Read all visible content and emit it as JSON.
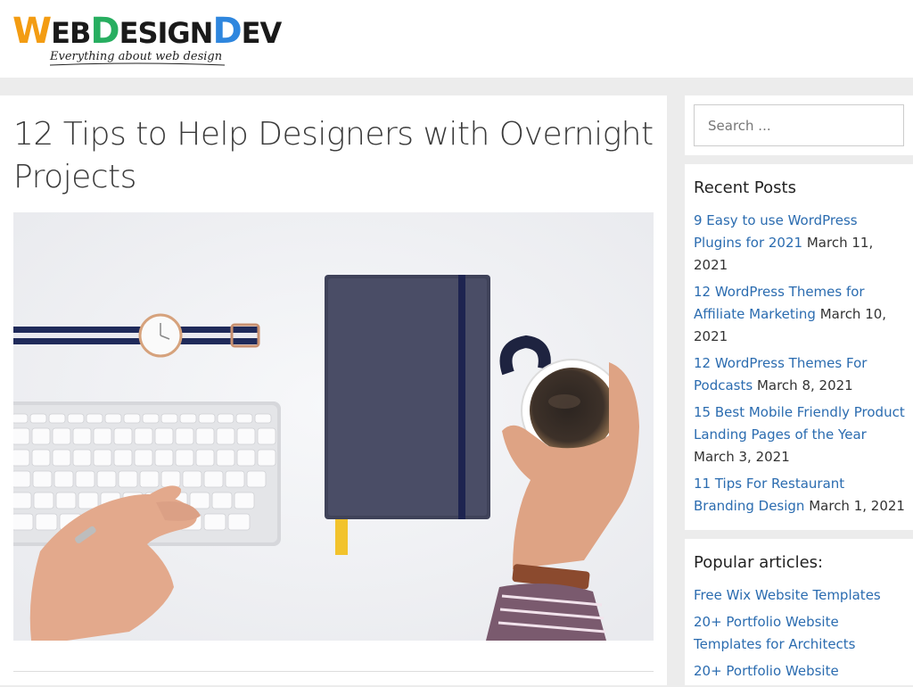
{
  "header": {
    "logo": {
      "w": "W",
      "eb": "EB",
      "d": "D",
      "esign": "ESIGN",
      "d2": "D",
      "ev": "EV",
      "tagline": "Everything about web design"
    }
  },
  "article": {
    "title": "12 Tips to Help Designers with Overnight Projects"
  },
  "sidebar": {
    "search": {
      "placeholder": "Search ..."
    },
    "recent_posts": {
      "title": "Recent Posts",
      "items": [
        {
          "label": "9 Easy to use WordPress Plugins for 2021",
          "date": "March 11, 2021"
        },
        {
          "label": "12 WordPress Themes for Affiliate Marketing",
          "date": "March 10, 2021"
        },
        {
          "label": "12 WordPress Themes For Podcasts",
          "date": "March 8, 2021"
        },
        {
          "label": "15 Best Mobile Friendly Product Landing Pages of the Year",
          "date": "March 3, 2021"
        },
        {
          "label": "11 Tips For Restaurant Branding Design",
          "date": "March 1, 2021"
        }
      ]
    },
    "popular": {
      "title": "Popular articles:",
      "items": [
        {
          "label": "Free Wix Website Templates"
        },
        {
          "label": "20+ Portfolio Website Templates for Architects"
        },
        {
          "label": "20+ Portfolio Website"
        }
      ]
    }
  },
  "colors": {
    "link": "#2b6cb0",
    "logo_orange": "#f39c12",
    "logo_green": "#27ae60",
    "logo_blue": "#2e86de"
  }
}
